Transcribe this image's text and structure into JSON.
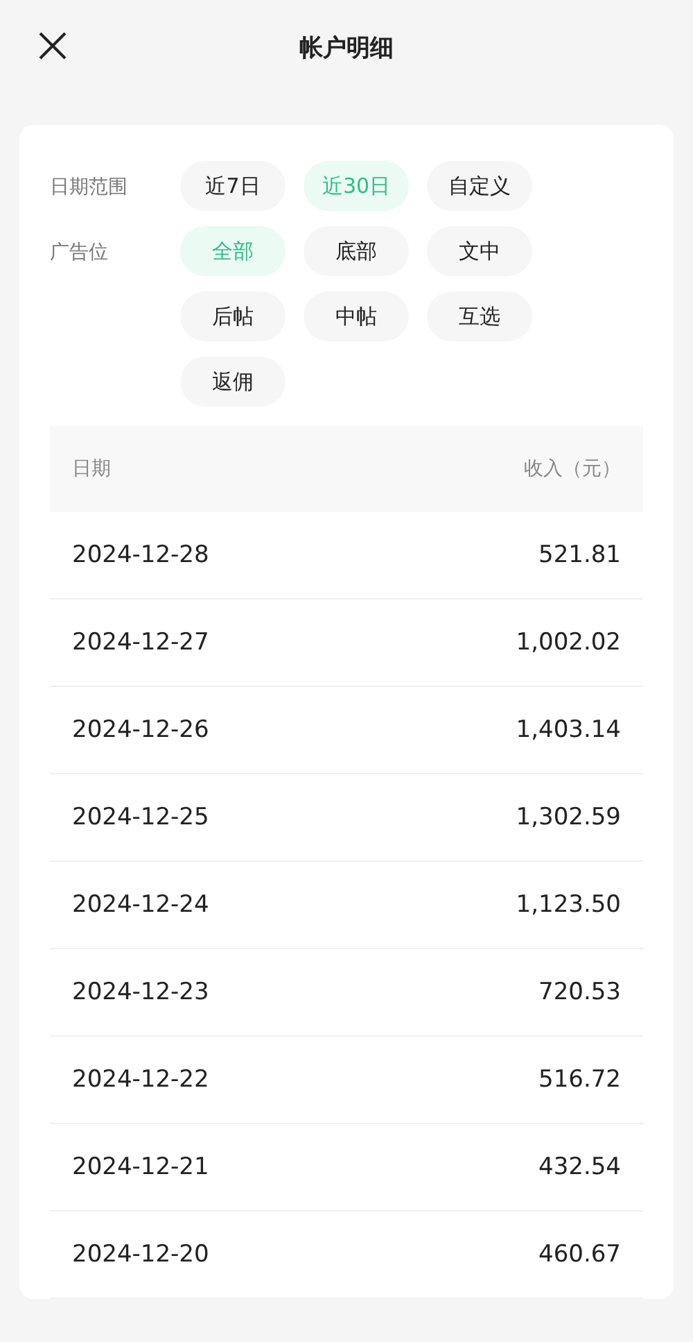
{
  "header": {
    "title": "帐户明细"
  },
  "filters": [
    {
      "label": "日期范围",
      "options": [
        {
          "label": "近7日",
          "selected": false
        },
        {
          "label": "近30日",
          "selected": true
        },
        {
          "label": "自定义",
          "selected": false
        }
      ]
    },
    {
      "label": "广告位",
      "options": [
        {
          "label": "全部",
          "selected": true
        },
        {
          "label": "底部",
          "selected": false
        },
        {
          "label": "文中",
          "selected": false
        },
        {
          "label": "后帖",
          "selected": false
        },
        {
          "label": "中帖",
          "selected": false
        },
        {
          "label": "互选",
          "selected": false
        },
        {
          "label": "返佣",
          "selected": false
        }
      ]
    }
  ],
  "table": {
    "columns": [
      "日期",
      "收入（元）"
    ],
    "rows": [
      [
        "2024-12-28",
        "521.81"
      ],
      [
        "2024-12-27",
        "1,002.02"
      ],
      [
        "2024-12-26",
        "1,403.14"
      ],
      [
        "2024-12-25",
        "1,302.59"
      ],
      [
        "2024-12-24",
        "1,123.50"
      ],
      [
        "2024-12-23",
        "720.53"
      ],
      [
        "2024-12-22",
        "516.72"
      ],
      [
        "2024-12-21",
        "432.54"
      ],
      [
        "2024-12-20",
        "460.67"
      ]
    ]
  }
}
